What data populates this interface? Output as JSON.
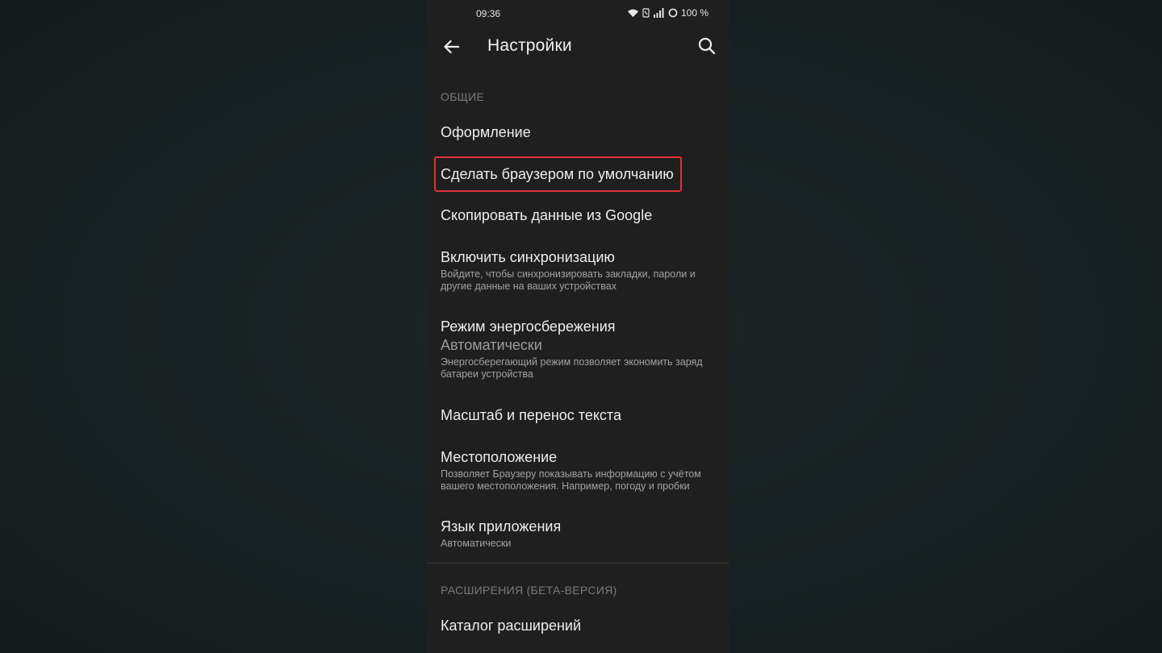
{
  "status_bar": {
    "time": "09:36",
    "battery": "100 %",
    "icons": [
      "wifi-icon",
      "nfc-icon",
      "signal-icon",
      "battery-ring-icon"
    ]
  },
  "app_bar": {
    "title": "Настройки",
    "back_icon": "arrow-left-icon",
    "search_icon": "search-icon"
  },
  "sections": {
    "general": {
      "header": "ОБЩИЕ",
      "items": [
        {
          "title": "Оформление"
        },
        {
          "title": "Сделать браузером по умолчанию"
        },
        {
          "title": "Скопировать данные из Google"
        },
        {
          "title": "Включить синхронизацию",
          "subtitle": "Войдите, чтобы синхронизировать закладки, пароли и другие данные на ваших устройствах"
        },
        {
          "title": "Режим энергосбережения",
          "value": "Автоматически",
          "subtitle": "Энергосберегающий режим позволяет экономить заряд батареи устройства"
        },
        {
          "title": "Масштаб и перенос текста"
        },
        {
          "title": "Местоположение",
          "subtitle": "Позволяет Браузеру показывать информацию с учётом вашего местоположения. Например, погоду и пробки"
        },
        {
          "title": "Язык приложения",
          "subtitle": "Автоматически"
        }
      ]
    },
    "extensions": {
      "header": "РАСШИРЕНИЯ (БЕТА-ВЕРСИЯ)",
      "items": [
        {
          "title": "Каталог расширений"
        }
      ]
    }
  },
  "colors": {
    "highlight": "#e0323a",
    "background": "#1f1f1f"
  }
}
